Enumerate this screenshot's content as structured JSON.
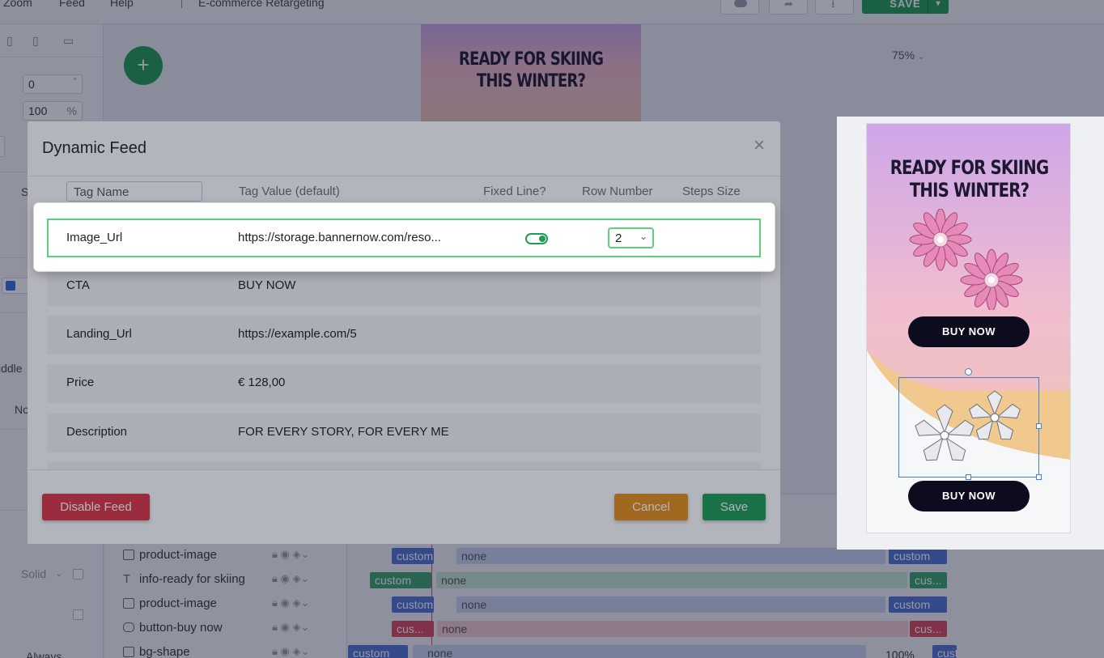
{
  "menubar": {
    "zoom": "Zoom",
    "feed": "Feed",
    "help": "Help",
    "project": "E-commerce Retargeting",
    "save": "SAVE"
  },
  "left_panel": {
    "rotation": "0",
    "rotation_unit": "°",
    "opacity": "100",
    "opacity_unit": "%",
    "s_label": "S",
    "middle_label": "iddle",
    "no_label": "No",
    "solid": "Solid",
    "always": "Always"
  },
  "canvas": {
    "add": "+",
    "zoom_value": "75%",
    "banner_title_line1": "READY FOR SKIING",
    "banner_title_line2": "THIS WINTER?"
  },
  "timeline": {
    "layers": [
      {
        "name": "product-image",
        "icon": "image-icon",
        "tag": "custom",
        "anim": "none",
        "end": "custom",
        "color": "#4f74d6"
      },
      {
        "name": "info-ready for skiing",
        "icon": "text-icon",
        "tag": "custom",
        "anim": "none",
        "end": "cus...",
        "color": "#3aa56b"
      },
      {
        "name": "product-image",
        "icon": "image-icon",
        "tag": "custom",
        "anim": "none",
        "end": "custom",
        "color": "#4f74d6"
      },
      {
        "name": "button-buy now",
        "icon": "button-icon",
        "tag": "cus...",
        "anim": "none",
        "end": "cus...",
        "color": "#d9485f"
      },
      {
        "name": "bg-shape",
        "icon": "shape-icon",
        "tag": "custom",
        "anim": "none",
        "end": "cust",
        "color": "#4f74d6"
      }
    ],
    "percent": "100%"
  },
  "modal": {
    "title": "Dynamic Feed",
    "close": "×",
    "columns": {
      "tag_name": "Tag Name",
      "tag_value": "Tag Value (default)",
      "fixed_line": "Fixed Line?",
      "row_number": "Row Number",
      "steps_size": "Steps Size"
    },
    "highlighted_row": {
      "name": "Image_Url",
      "value": "https://storage.bannernow.com/reso...",
      "fixed_line": true,
      "row_number": "2"
    },
    "rows": [
      {
        "name": "CTA",
        "value": "BUY NOW"
      },
      {
        "name": "Landing_Url",
        "value": "https://example.com/5"
      },
      {
        "name": "Price",
        "value": "€ 128,00"
      },
      {
        "name": "Description",
        "value": "FOR EVERY STORY, FOR EVERY ME"
      }
    ],
    "disable_feed": "Disable Feed",
    "cancel": "Cancel",
    "save": "Save"
  },
  "preview": {
    "title_line1": "READY FOR SKIING",
    "title_line2": "THIS WINTER?",
    "buy_now_1": "BUY NOW",
    "buy_now_2": "BUY NOW"
  },
  "colors": {
    "primary_green": "#1f9d55",
    "danger_red": "#dc3545",
    "warning_orange": "#e5901a",
    "highlight_green": "#5dd07c"
  }
}
